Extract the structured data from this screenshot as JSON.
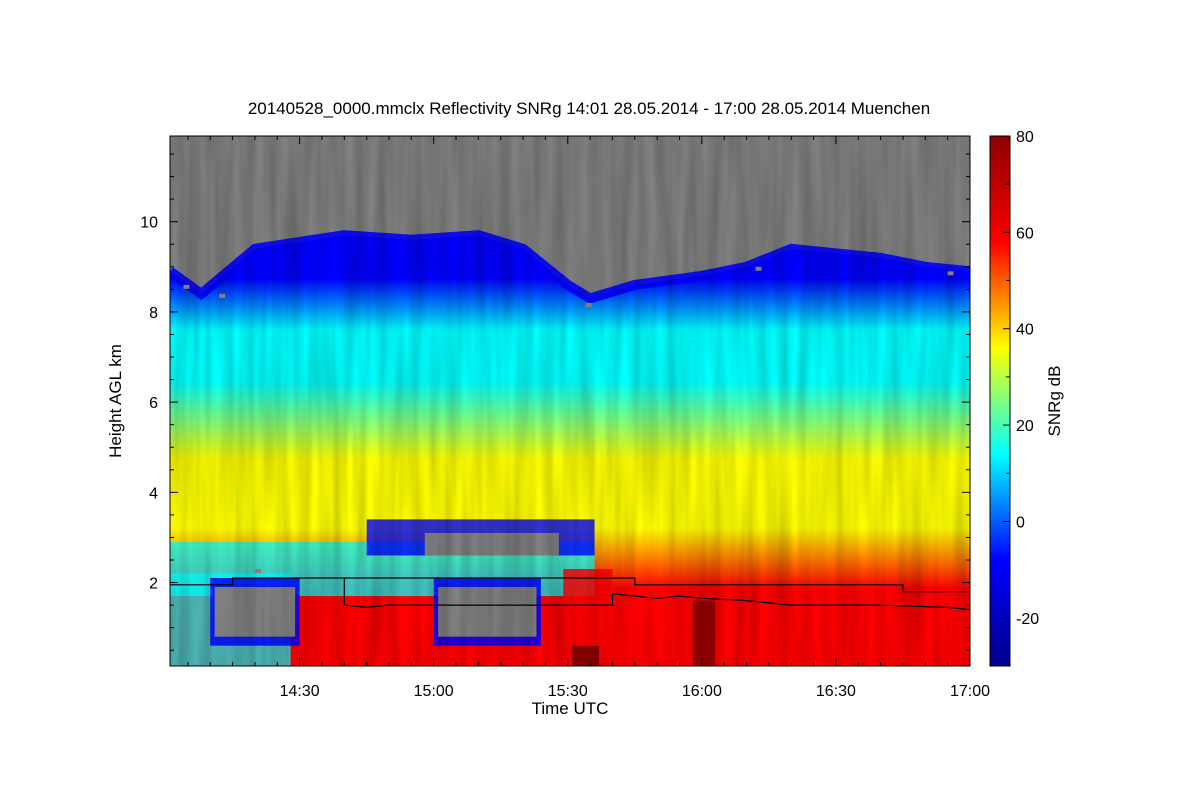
{
  "chart_data": {
    "type": "heatmap",
    "title": "20140528_0000.mmclx Reflectivity SNRg   14:01 28.05.2014 - 17:00 28.05.2014 Muenchen",
    "xlabel": "Time UTC",
    "ylabel": "Height AGL km",
    "colorbar_label": "SNRg dB",
    "xlim": [
      "14:01",
      "17:00"
    ],
    "ylim": [
      0.15,
      11.9
    ],
    "x_ticks": [
      "14:30",
      "15:00",
      "15:30",
      "16:00",
      "16:30",
      "17:00"
    ],
    "y_ticks": [
      2,
      4,
      6,
      8,
      10
    ],
    "colorbar_range": [
      -30,
      80
    ],
    "colorbar_ticks": [
      -20,
      0,
      20,
      40,
      60,
      80
    ],
    "colormap": [
      "#00008b",
      "#0000ff",
      "#00ffff",
      "#ffff00",
      "#ff0000",
      "#8b0000"
    ],
    "no_signal_color": "#808080",
    "line_color": "#000000",
    "cloud_top_km": [
      {
        "t": "14:01",
        "h": 8.9
      },
      {
        "t": "14:08",
        "h": 8.4
      },
      {
        "t": "14:20",
        "h": 9.4
      },
      {
        "t": "14:40",
        "h": 9.7
      },
      {
        "t": "14:55",
        "h": 9.6
      },
      {
        "t": "15:10",
        "h": 9.7
      },
      {
        "t": "15:20",
        "h": 9.4
      },
      {
        "t": "15:30",
        "h": 8.6
      },
      {
        "t": "15:35",
        "h": 8.3
      },
      {
        "t": "15:45",
        "h": 8.6
      },
      {
        "t": "16:00",
        "h": 8.8
      },
      {
        "t": "16:10",
        "h": 9.0
      },
      {
        "t": "16:20",
        "h": 9.4
      },
      {
        "t": "16:30",
        "h": 9.3
      },
      {
        "t": "16:40",
        "h": 9.2
      },
      {
        "t": "16:50",
        "h": 9.0
      },
      {
        "t": "17:00",
        "h": 8.9
      }
    ],
    "series": [
      {
        "points": [
          {
            "t": "14:01",
            "h": 1.95
          },
          {
            "t": "14:15",
            "h": 1.95
          },
          {
            "t": "14:15",
            "h": 2.1
          },
          {
            "t": "15:45",
            "h": 2.1
          },
          {
            "t": "15:45",
            "h": 1.95
          },
          {
            "t": "16:45",
            "h": 1.95
          },
          {
            "t": "16:45",
            "h": 1.8
          },
          {
            "t": "17:00",
            "h": 1.8
          }
        ]
      },
      {
        "points": [
          {
            "t": "14:40",
            "h": 2.1
          },
          {
            "t": "14:40",
            "h": 1.5
          },
          {
            "t": "14:45",
            "h": 1.45
          },
          {
            "t": "14:50",
            "h": 1.5
          },
          {
            "t": "15:00",
            "h": 1.5
          },
          {
            "t": "15:40",
            "h": 1.5
          },
          {
            "t": "15:40",
            "h": 1.75
          },
          {
            "t": "15:45",
            "h": 1.7
          },
          {
            "t": "15:50",
            "h": 1.65
          },
          {
            "t": "15:55",
            "h": 1.7
          },
          {
            "t": "16:00",
            "h": 1.65
          },
          {
            "t": "16:10",
            "h": 1.6
          },
          {
            "t": "16:20",
            "h": 1.5
          },
          {
            "t": "16:40",
            "h": 1.5
          },
          {
            "t": "16:55",
            "h": 1.45
          },
          {
            "t": "17:00",
            "h": 1.4
          }
        ]
      }
    ]
  }
}
